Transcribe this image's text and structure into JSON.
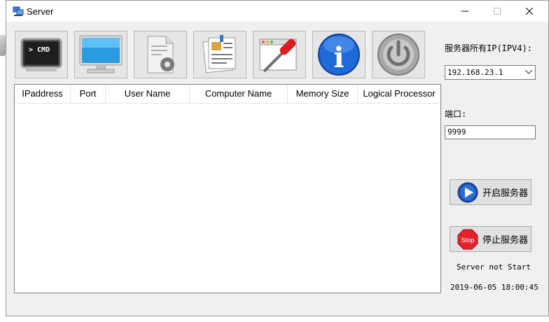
{
  "window": {
    "title": "Server"
  },
  "toolbar": {
    "buttons": [
      {
        "name": "cmd",
        "glyph": "> CMD"
      },
      {
        "name": "computer"
      },
      {
        "name": "settings"
      },
      {
        "name": "documents"
      },
      {
        "name": "tools"
      },
      {
        "name": "info",
        "glyph": "i"
      },
      {
        "name": "power"
      }
    ]
  },
  "table": {
    "columns": [
      "IPaddress",
      "Port",
      "User Name",
      "Computer Name",
      "Memory Size",
      "Logical Processor"
    ],
    "rows": []
  },
  "side": {
    "ip_label": "服务器所有IP(IPV4):",
    "ip_selected": "192.168.23.1",
    "port_label": "端口:",
    "port_value": "9999",
    "start_label": "开启服务器",
    "stop_label": "停止服务器",
    "stop_icon_text": "Stop",
    "status": "Server not Start",
    "datetime": "2019-06-05 18:00:45"
  },
  "colors": {
    "accent": "#1e6ad6",
    "stop_red": "#e3222b"
  }
}
